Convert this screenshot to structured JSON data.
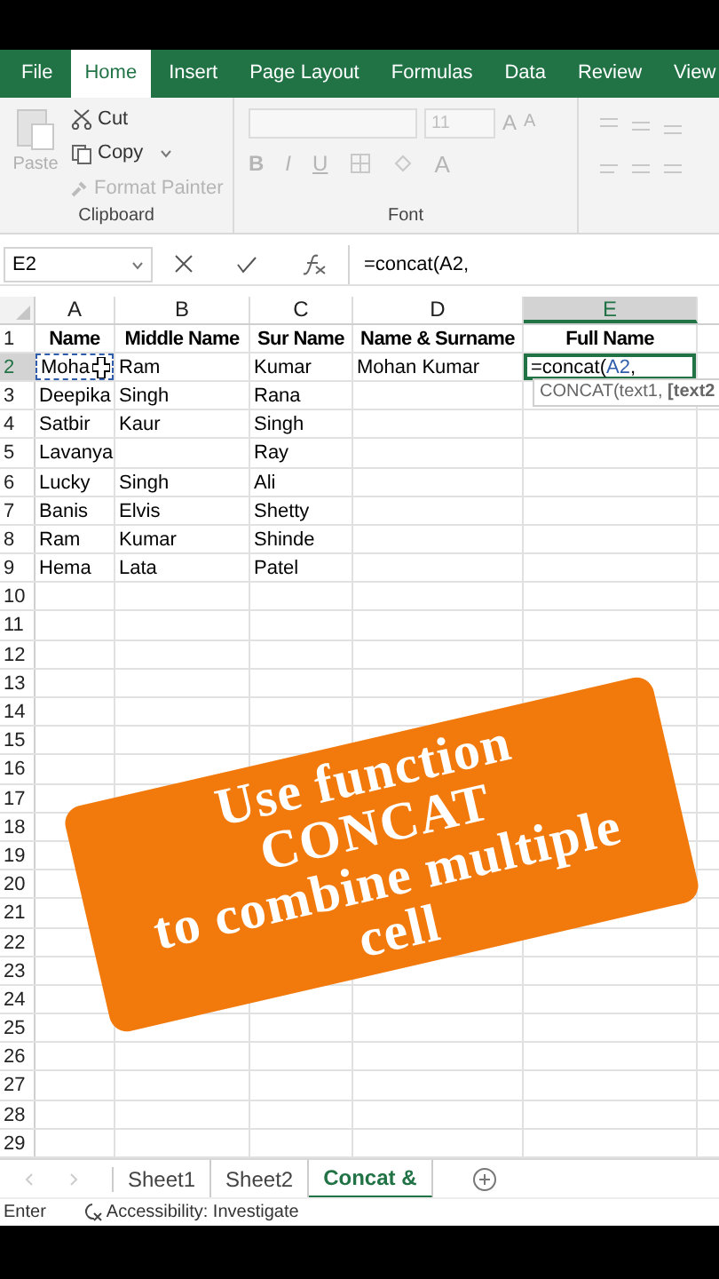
{
  "ribbon_tabs": [
    {
      "label": "File",
      "selected": false
    },
    {
      "label": "Home",
      "selected": true
    },
    {
      "label": "Insert",
      "selected": false
    },
    {
      "label": "Page Layout",
      "selected": false
    },
    {
      "label": "Formulas",
      "selected": false
    },
    {
      "label": "Data",
      "selected": false
    },
    {
      "label": "Review",
      "selected": false
    },
    {
      "label": "View",
      "selected": false
    }
  ],
  "clipboard": {
    "paste": "Paste",
    "cut": "Cut",
    "copy": "Copy",
    "format_painter": "Format Painter",
    "label": "Clipboard"
  },
  "font": {
    "size": "11",
    "label": "Font",
    "top_tools": [
      {
        "kind": "grow",
        "label": "A"
      },
      {
        "kind": "shrink",
        "label": "A"
      }
    ],
    "bottom_tools": [
      {
        "kind": "bold",
        "label": "B"
      },
      {
        "kind": "italic",
        "label": "I"
      },
      {
        "kind": "underline",
        "label": "U"
      },
      {
        "kind": "borders"
      },
      {
        "kind": "fill"
      },
      {
        "kind": "color",
        "label": "A"
      }
    ]
  },
  "name_box": "E2",
  "formula": "=concat(A2,",
  "columns": [
    {
      "label": "A",
      "selected": false
    },
    {
      "label": "B",
      "selected": false
    },
    {
      "label": "C",
      "selected": false
    },
    {
      "label": "D",
      "selected": false
    },
    {
      "label": "E",
      "selected": true
    }
  ],
  "rows": [
    {
      "number": "1",
      "selected": false,
      "header": true,
      "cells": [
        "Name",
        "Middle Name",
        "Sur Name",
        "Name & Surname",
        "Full Name"
      ]
    },
    {
      "number": "2",
      "selected": true,
      "header": false,
      "cells": [
        {
          "kind": "referenced",
          "text": "Moha"
        },
        "Ram",
        "Kumar",
        "Mohan Kumar",
        {
          "kind": "editing",
          "before": "=concat(",
          "ref": "A2",
          "after": ","
        }
      ]
    },
    {
      "number": "3",
      "selected": false,
      "header": false,
      "cells": [
        "Deepika",
        "Singh",
        "Rana"
      ]
    },
    {
      "number": "4",
      "selected": false,
      "header": false,
      "cells": [
        "Satbir",
        "Kaur",
        "Singh"
      ]
    },
    {
      "number": "5",
      "selected": false,
      "header": false,
      "cells": [
        "Lavanya",
        "",
        "Ray"
      ]
    },
    {
      "number": "6",
      "selected": false,
      "header": false,
      "cells": [
        "Lucky",
        "Singh",
        "Ali"
      ]
    },
    {
      "number": "7",
      "selected": false,
      "header": false,
      "cells": [
        "Banis",
        "Elvis",
        "Shetty"
      ]
    },
    {
      "number": "8",
      "selected": false,
      "header": false,
      "cells": [
        "Ram",
        "Kumar",
        "Shinde"
      ]
    },
    {
      "number": "9",
      "selected": false,
      "header": false,
      "cells": [
        "Hema",
        "Lata",
        "Patel"
      ]
    },
    {
      "number": "10",
      "selected": false
    },
    {
      "number": "11",
      "selected": false
    },
    {
      "number": "12",
      "selected": false
    },
    {
      "number": "13",
      "selected": false
    },
    {
      "number": "14",
      "selected": false
    },
    {
      "number": "15",
      "selected": false
    },
    {
      "number": "16",
      "selected": false
    },
    {
      "number": "17",
      "selected": false
    },
    {
      "number": "18",
      "selected": false
    },
    {
      "number": "19",
      "selected": false
    },
    {
      "number": "20",
      "selected": false
    },
    {
      "number": "21",
      "selected": false
    },
    {
      "number": "22",
      "selected": false
    },
    {
      "number": "23",
      "selected": false
    },
    {
      "number": "24",
      "selected": false
    },
    {
      "number": "25",
      "selected": false
    },
    {
      "number": "26",
      "selected": false
    },
    {
      "number": "27",
      "selected": false
    },
    {
      "number": "28",
      "selected": false
    },
    {
      "number": "29",
      "selected": false
    }
  ],
  "tooltip": "CONCAT(text1, **[text2**",
  "banner": {
    "lines": [
      "Use function",
      "CONCAT",
      "to combine multiple",
      "cell"
    ]
  },
  "sheet_tabs": [
    {
      "label": "Sheet1",
      "selected": false
    },
    {
      "label": "Sheet2",
      "selected": false
    },
    {
      "label": "Concat &",
      "selected": true
    }
  ],
  "status_bar": {
    "mode": "Enter",
    "accessibility": "Accessibility: Investigate"
  }
}
